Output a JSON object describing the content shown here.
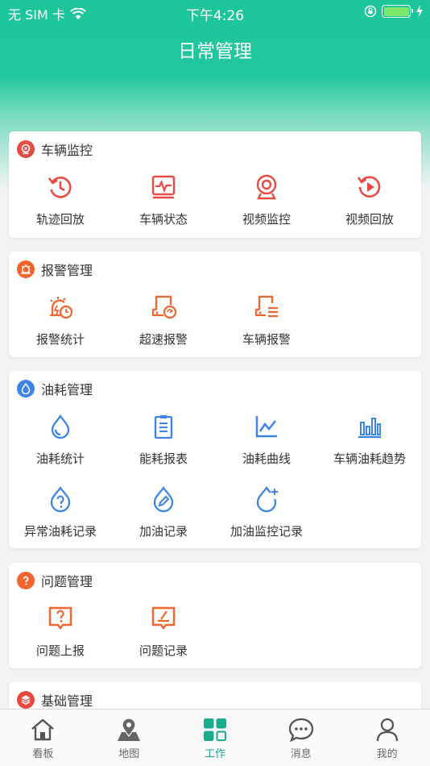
{
  "status_bar": {
    "carrier": "无 SIM 卡",
    "time": "下午4:26"
  },
  "title": "日常管理",
  "colors": {
    "accent": "#1aac8c",
    "red": "#e94a42",
    "orange": "#f2652e",
    "blue": "#3c84e6"
  },
  "sections": {
    "vehicle": {
      "title": "车辆监控",
      "icon": "camera-badge-icon",
      "items": [
        "轨迹回放",
        "车辆状态",
        "视频监控",
        "视频回放"
      ]
    },
    "alarm": {
      "title": "报警管理",
      "icon": "alarm-badge-icon",
      "items": [
        "报警统计",
        "超速报警",
        "车辆报警"
      ]
    },
    "fuel": {
      "title": "油耗管理",
      "icon": "drop-badge-icon",
      "items": [
        "油耗统计",
        "能耗报表",
        "油耗曲线",
        "车辆油耗趋势",
        "异常油耗记录",
        "加油记录",
        "加油监控记录"
      ]
    },
    "issue": {
      "title": "问题管理",
      "icon": "question-badge-icon",
      "items": [
        "问题上报",
        "问题记录"
      ]
    },
    "basic": {
      "title": "基础管理",
      "icon": "layers-badge-icon"
    }
  },
  "tabbar": [
    "看板",
    "地图",
    "工作",
    "消息",
    "我的"
  ],
  "active_tab": "工作"
}
